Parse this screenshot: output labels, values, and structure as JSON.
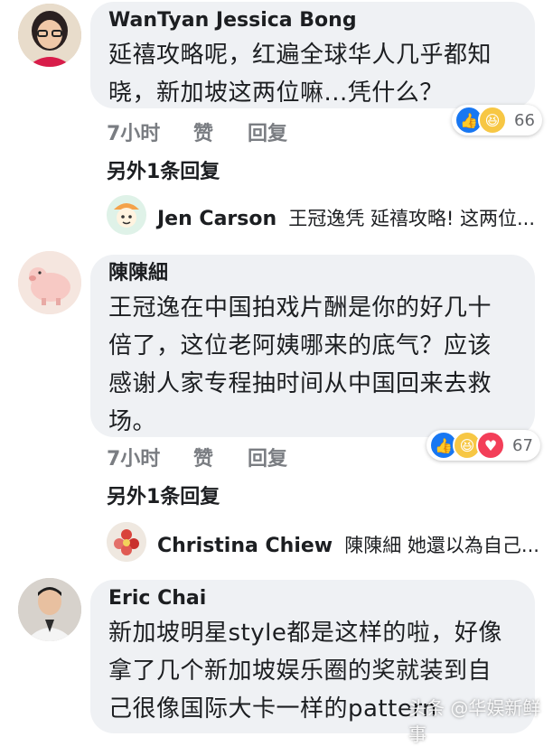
{
  "comments": [
    {
      "name": "WanTyan Jessica Bong",
      "lines": [
        "延禧攻略呢，红遍全球华人几乎都知",
        "晓，新加坡这两位嘛...凭什么？"
      ],
      "time": "7小时",
      "like": "赞",
      "reply": "回复",
      "reaction_count": "66",
      "more_replies": "另外1条回复",
      "reply_preview": {
        "name": "Jen Carson",
        "text": "王冠逸凭 延禧攻略! 这两位..."
      }
    },
    {
      "name": "陳陳細",
      "lines": [
        "王冠逸在中国拍戏片酬是你的好几十",
        "倍了，这位老阿姨哪来的底气？应该",
        "感谢人家专程抽时间从中国回来去救",
        "场。"
      ],
      "time": "7小时",
      "like": "赞",
      "reply": "回复",
      "reaction_count": "67",
      "more_replies": "另外1条回复",
      "reply_preview": {
        "name": "Christina Chiew",
        "text": "陳陳細 她還以為自己..."
      }
    },
    {
      "name": "Eric Chai",
      "lines": [
        "新加坡明星style都是这样的啦，好像",
        "拿了几个新加坡娱乐圈的奖就装到自",
        "己很像国际大卡一样的pattern"
      ]
    }
  ],
  "watermark": "头条 @华娱新鲜事"
}
